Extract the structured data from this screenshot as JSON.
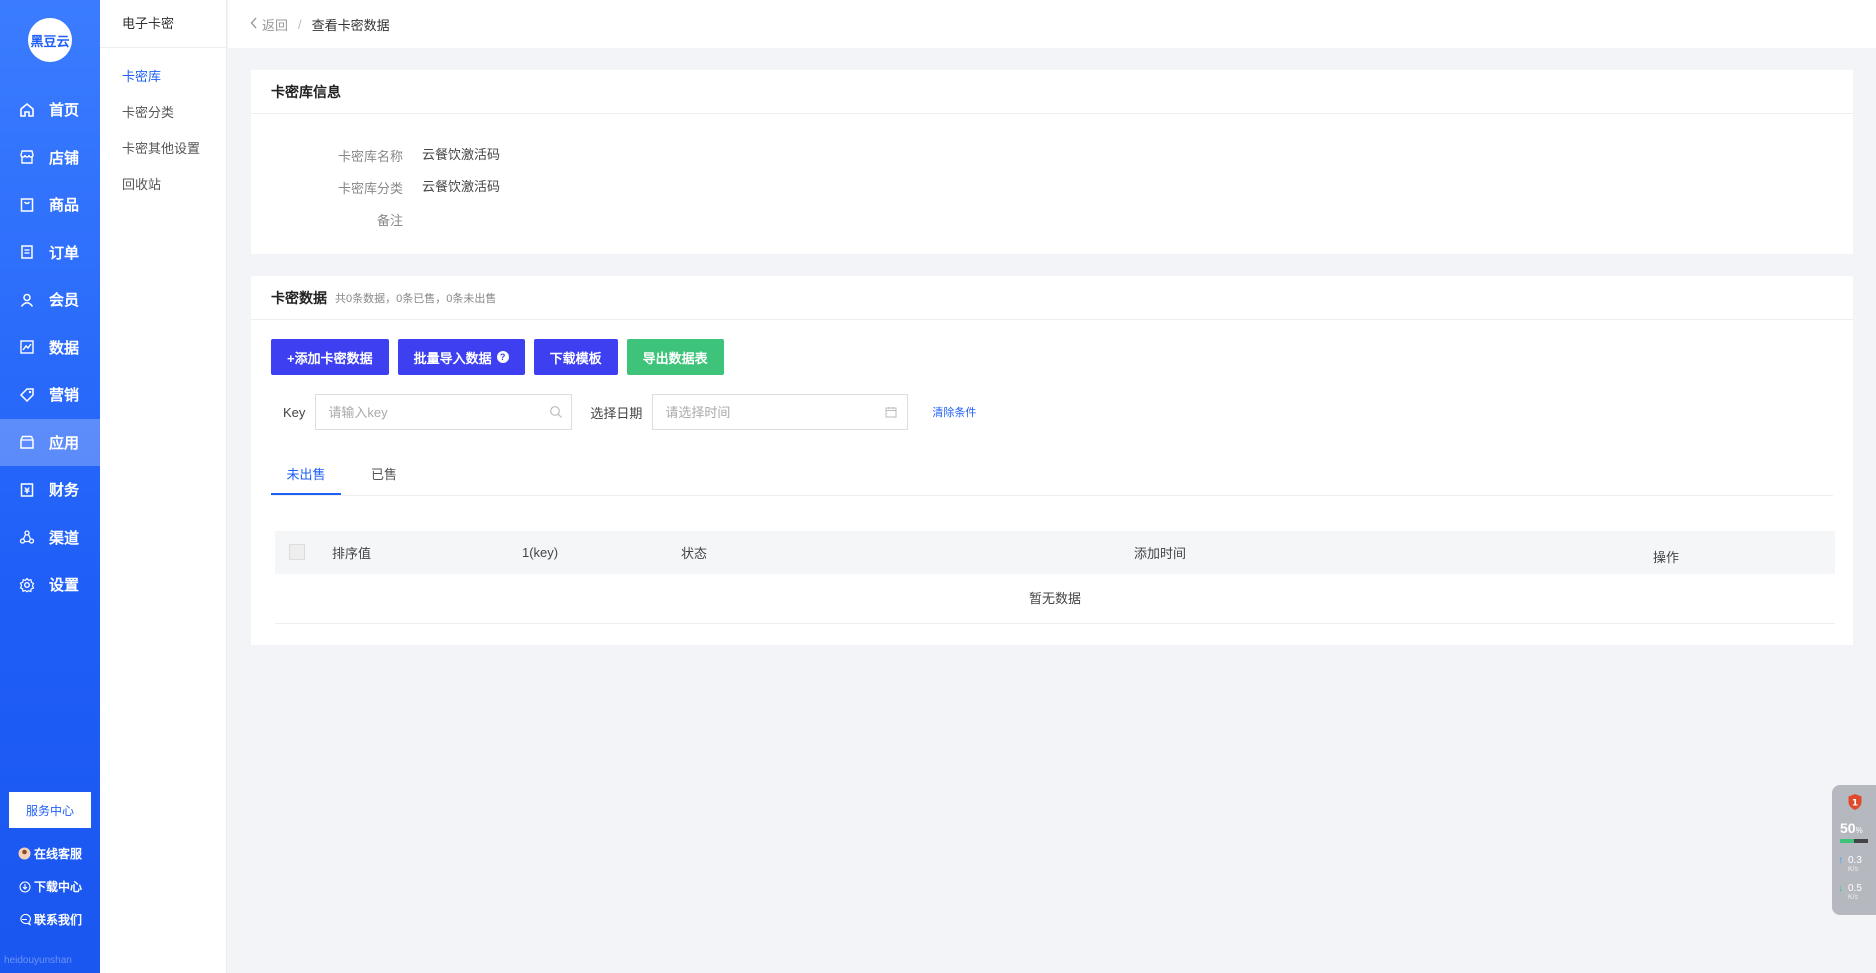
{
  "brand": {
    "logo_text": "黑豆云",
    "footer": "heidouyunshan"
  },
  "nav": {
    "items": [
      {
        "label": "首页",
        "icon": "home-icon"
      },
      {
        "label": "店铺",
        "icon": "store-icon"
      },
      {
        "label": "商品",
        "icon": "goods-icon"
      },
      {
        "label": "订单",
        "icon": "order-icon"
      },
      {
        "label": "会员",
        "icon": "member-icon"
      },
      {
        "label": "数据",
        "icon": "chart-icon"
      },
      {
        "label": "营销",
        "icon": "tag-icon"
      },
      {
        "label": "应用",
        "icon": "app-icon",
        "active": true
      },
      {
        "label": "财务",
        "icon": "finance-icon"
      },
      {
        "label": "渠道",
        "icon": "channel-icon"
      },
      {
        "label": "设置",
        "icon": "gear-icon"
      }
    ],
    "service_center": "服务中心",
    "online_service": "在线客服",
    "download_center": "下载中心",
    "contact_us": "联系我们"
  },
  "subnav": {
    "title": "电子卡密",
    "items": [
      "卡密库",
      "卡密分类",
      "卡密其他设置",
      "回收站"
    ]
  },
  "breadcrumb": {
    "back": "返回",
    "sep": "/",
    "current": "查看卡密数据"
  },
  "info_card": {
    "title": "卡密库信息",
    "rows": [
      {
        "label": "卡密库名称",
        "value": "云餐饮激活码"
      },
      {
        "label": "卡密库分类",
        "value": "云餐饮激活码"
      },
      {
        "label": "备注",
        "value": ""
      }
    ]
  },
  "data_card": {
    "title": "卡密数据",
    "summary": "共0条数据，0条已售，0条未出售",
    "buttons": {
      "add": "+添加卡密数据",
      "import": "批量导入数据",
      "template": "下载模板",
      "export": "导出数据表"
    },
    "filters": {
      "key_label": "Key",
      "key_placeholder": "请输入key",
      "date_label": "选择日期",
      "date_placeholder": "请选择时间",
      "clear": "清除条件"
    },
    "tabs": [
      "未出售",
      "已售"
    ],
    "columns": [
      "排序值",
      "1(key)",
      "状态",
      "添加时间",
      "操作"
    ],
    "empty": "暂无数据"
  },
  "widget": {
    "badge": "1",
    "percent": "50",
    "percent_unit": "%",
    "up_value": "0.3",
    "down_value": "0.5",
    "unit": "K/s"
  },
  "colors": {
    "primary": "#1f5ff7",
    "button_blue": "#3d3ff0",
    "button_green": "#3ec47a"
  }
}
